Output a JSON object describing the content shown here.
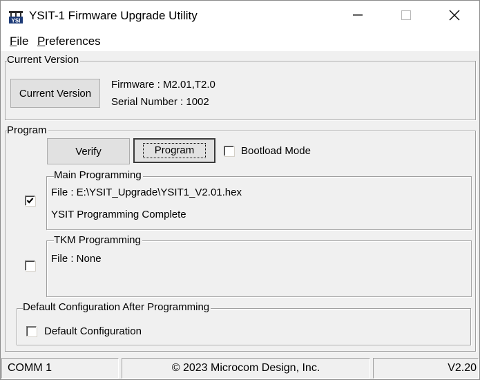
{
  "window": {
    "title": "YSIT-1 Firmware Upgrade Utility",
    "icon": "ysi-logo-icon",
    "controls": {
      "minimize": "—",
      "maximize": "☐",
      "close": "✕"
    }
  },
  "menu": {
    "file_hotkey": "F",
    "file_rest": "ile",
    "prefs_hotkey": "P",
    "prefs_rest": "references"
  },
  "current_version": {
    "group_label": "Current Version",
    "button_label": "Current Version",
    "firmware": "Firmware : M2.01,T2.0",
    "serial": "Serial Number : 1002"
  },
  "program": {
    "group_label": "Program",
    "verify_label": "Verify",
    "program_label": "Program",
    "bootload_label": "Bootload Mode",
    "bootload_checked": false,
    "main": {
      "group_label": "Main Programming",
      "checked": true,
      "file": "File :  E:\\YSIT_Upgrade\\YSIT1_V2.01.hex",
      "status": "YSIT Programming Complete"
    },
    "tkm": {
      "group_label": "TKM Programming",
      "checked": false,
      "file": "File :  None"
    },
    "default_config": {
      "group_label": "Default Configuration After Programming",
      "checkbox_label": "Default Configuration",
      "checked": false
    }
  },
  "statusbar": {
    "port": "COMM 1",
    "copyright": "© 2023 Microcom Design, Inc.",
    "version": "V2.20"
  }
}
